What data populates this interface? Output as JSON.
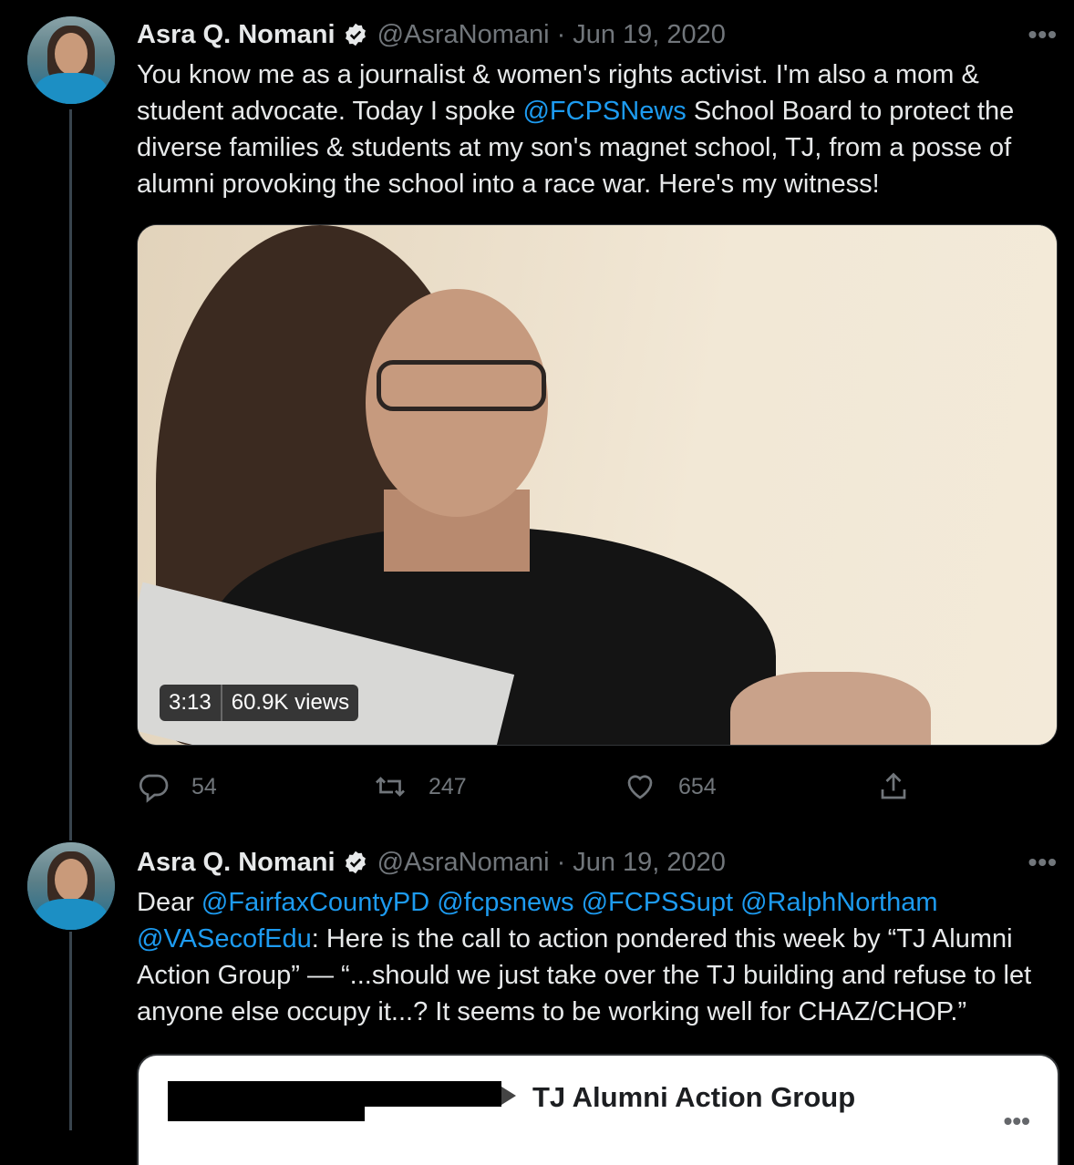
{
  "tweets": [
    {
      "name": "Asra Q. Nomani",
      "handle": "@AsraNomani",
      "separator": "·",
      "date": "Jun 19, 2020",
      "more": "•••",
      "text_parts": [
        "You know me as a journalist & women's rights activist. I'm also a mom & student advocate. Today I spoke ",
        "@FCPSNews",
        " School Board to protect the diverse families & students at my son's magnet school, TJ, from a posse of alumni provoking the school into a race war. Here's my witness!"
      ],
      "video": {
        "duration": "3:13",
        "views": "60.9K views"
      },
      "actions": {
        "replies": "54",
        "retweets": "247",
        "likes": "654"
      }
    },
    {
      "name": "Asra Q. Nomani",
      "handle": "@AsraNomani",
      "separator": "·",
      "date": "Jun 19, 2020",
      "more": "•••",
      "text_parts": [
        "Dear ",
        "@FairfaxCountyPD @fcpsnews @FCPSSupt @RalphNortham @VASecofEdu",
        ": Here is the call to action pondered this week by “TJ Alumni Action Group” — “...should we just take over the TJ building and refuse to let anyone else occupy it...? It seems to be working well for CHAZ/CHOP.”"
      ],
      "card": {
        "group_name": "TJ Alumni Action Group",
        "more": "•••"
      }
    }
  ],
  "colors": {
    "link": "#1d9bf0",
    "muted": "#71767b",
    "background": "#000000",
    "text": "#e7e9ea"
  },
  "icons": [
    "verified-badge-icon",
    "reply-icon",
    "retweet-icon",
    "like-icon",
    "share-icon",
    "more-icon"
  ]
}
